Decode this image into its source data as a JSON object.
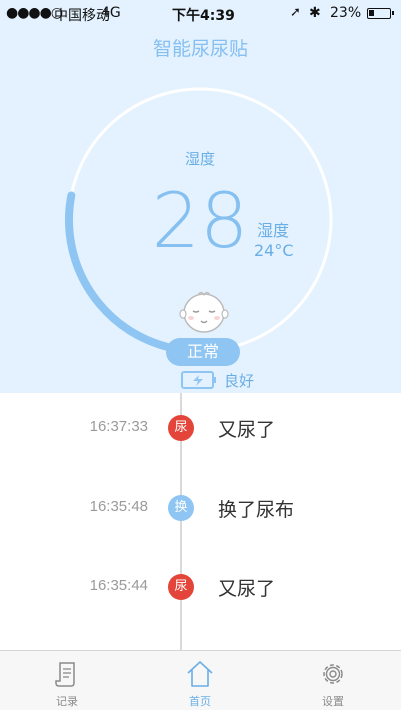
{
  "status_bar": {
    "signal": "●●●●○",
    "carrier": "中国移动",
    "network": "4G",
    "time": "下午4:39",
    "location_glyph": "➚",
    "bluetooth_glyph": "✱",
    "battery_percent": "23%",
    "battery_level": 0.23
  },
  "header": {
    "title": "智能尿尿贴"
  },
  "gauge": {
    "humidity_label": "湿度",
    "humidity_value": "28",
    "side_label": "湿度",
    "temperature": "24°C",
    "humidity_level": 0.28,
    "status": "正常",
    "battery_status": "良好"
  },
  "timeline": [
    {
      "time": "16:37:33",
      "badge": "尿",
      "type": "pee",
      "text": "又尿了"
    },
    {
      "time": "16:35:48",
      "badge": "换",
      "type": "change",
      "text": "换了尿布"
    },
    {
      "time": "16:35:44",
      "badge": "尿",
      "type": "pee",
      "text": "又尿了"
    }
  ],
  "tabbar": {
    "records": "记录",
    "home": "首页",
    "settings": "设置"
  },
  "colors": {
    "accent": "#86bff1",
    "top_background": "#e3f2fe",
    "pee_badge": "#e4453b",
    "change_badge": "#8fc5f2"
  }
}
